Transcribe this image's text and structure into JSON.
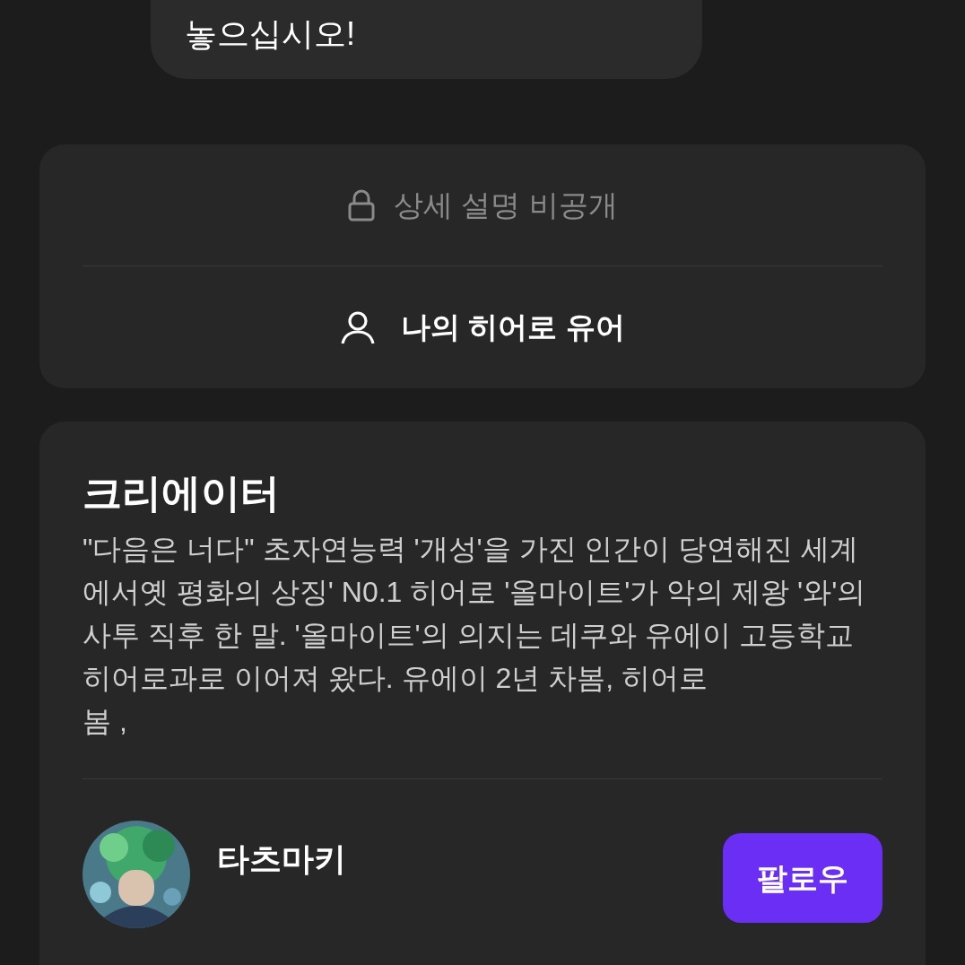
{
  "message_bubble": {
    "text": "놓으십시오!"
  },
  "info_card": {
    "private_description": "상세 설명 비공개",
    "user_persona": "나의 히어로 유어"
  },
  "creator_card": {
    "title": "크리에이터",
    "description": "\"다음은 너다\" 초자연능력 '개성'을 가진 인간이 당연해진 세계에서옛 평화의 상징' N0.1 히어로 '올마이트'가 악의 제왕 '와'의 사투 직후 한 말. '올마이트'의 의지는 데쿠와 유에이 고등학교 히어로과로 이어져 왔다. 유에이 2년 차봄, 히어로\n봄 ,",
    "creator": {
      "name": "타츠마키",
      "follow_button": "팔로우"
    }
  }
}
